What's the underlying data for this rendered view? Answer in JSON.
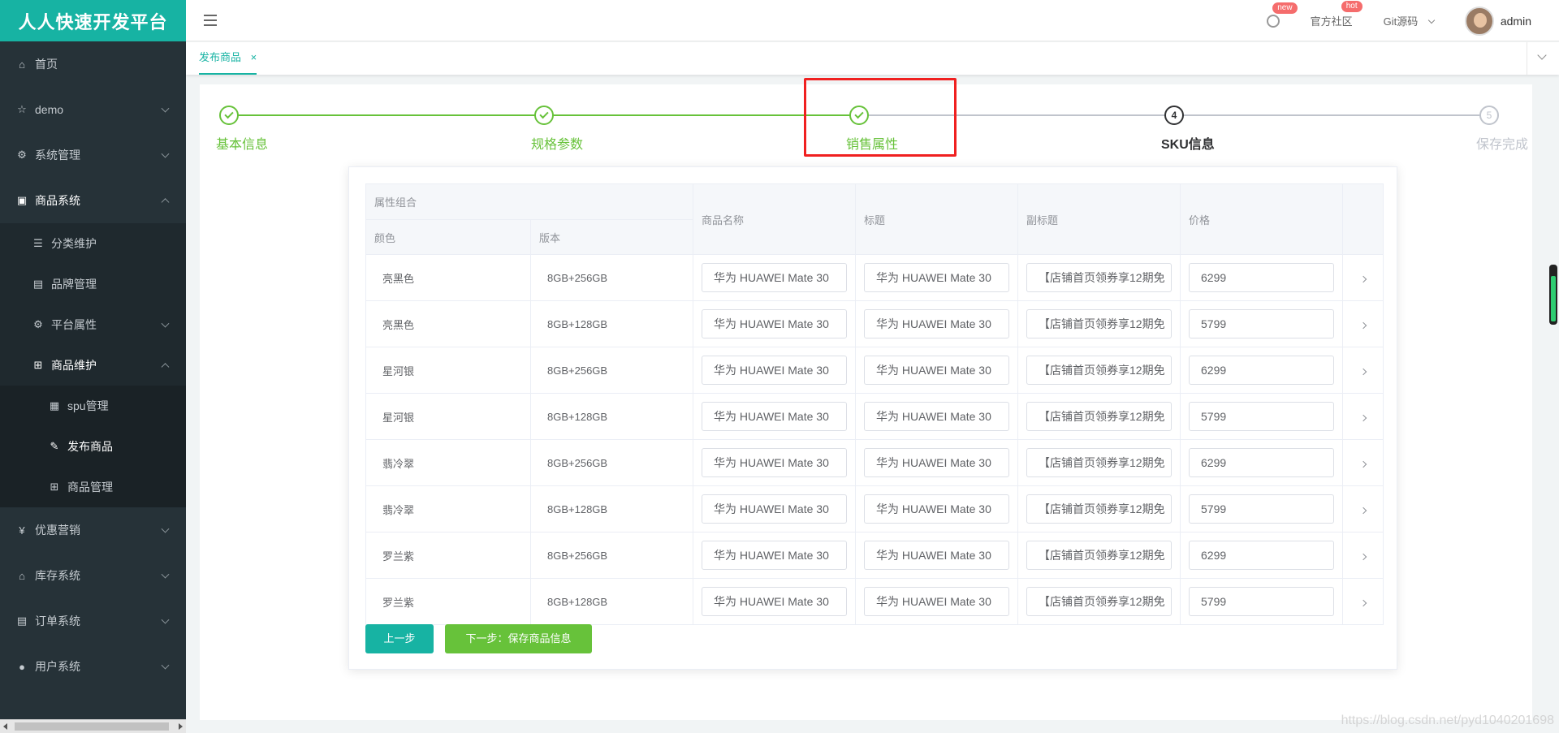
{
  "brand": "人人快速开发平台",
  "sidebar": {
    "items": [
      {
        "label": "首页",
        "icon": "home-icon"
      },
      {
        "label": "demo",
        "icon": "star-icon"
      },
      {
        "label": "系统管理",
        "icon": "gear-icon"
      },
      {
        "label": "商品系统",
        "icon": "product-icon"
      },
      {
        "label": "分类维护",
        "icon": "list-icon"
      },
      {
        "label": "品牌管理",
        "icon": "brand-icon"
      },
      {
        "label": "平台属性",
        "icon": "gear-icon"
      },
      {
        "label": "商品维护",
        "icon": "grid-icon"
      },
      {
        "label": "spu管理",
        "icon": "doc-icon"
      },
      {
        "label": "发布商品",
        "icon": "edit-icon"
      },
      {
        "label": "商品管理",
        "icon": "grid-icon"
      },
      {
        "label": "优惠营销",
        "icon": "discount-icon"
      },
      {
        "label": "库存系统",
        "icon": "warehouse-icon"
      },
      {
        "label": "订单系统",
        "icon": "order-icon"
      },
      {
        "label": "用户系统",
        "icon": "user-icon"
      }
    ]
  },
  "header": {
    "badge_new": "new",
    "community": "官方社区",
    "badge_hot": "hot",
    "git": "Git源码",
    "user": "admin"
  },
  "tabs": {
    "active": "发布商品",
    "close": "×"
  },
  "steps": [
    {
      "title": "基本信息",
      "status": "done"
    },
    {
      "title": "规格参数",
      "status": "done"
    },
    {
      "title": "销售属性",
      "status": "done"
    },
    {
      "title": "SKU信息",
      "status": "process",
      "num": "4"
    },
    {
      "title": "保存完成",
      "status": "wait",
      "num": "5"
    }
  ],
  "table": {
    "group_header": "属性组合",
    "headers": {
      "color": "颜色",
      "version": "版本",
      "name": "商品名称",
      "title": "标题",
      "subtitle": "副标题",
      "price": "价格"
    },
    "rows": [
      {
        "color": "亮黑色",
        "version": "8GB+256GB",
        "name": "华为 HUAWEI Mate 30",
        "title": "华为 HUAWEI Mate 30",
        "subtitle": "【店铺首页领券享12期免",
        "price": "6299"
      },
      {
        "color": "亮黑色",
        "version": "8GB+128GB",
        "name": "华为 HUAWEI Mate 30",
        "title": "华为 HUAWEI Mate 30",
        "subtitle": "【店铺首页领券享12期免",
        "price": "5799"
      },
      {
        "color": "星河银",
        "version": "8GB+256GB",
        "name": "华为 HUAWEI Mate 30",
        "title": "华为 HUAWEI Mate 30",
        "subtitle": "【店铺首页领券享12期免",
        "price": "6299"
      },
      {
        "color": "星河银",
        "version": "8GB+128GB",
        "name": "华为 HUAWEI Mate 30",
        "title": "华为 HUAWEI Mate 30",
        "subtitle": "【店铺首页领券享12期免",
        "price": "5799"
      },
      {
        "color": "翡冷翠",
        "version": "8GB+256GB",
        "name": "华为 HUAWEI Mate 30",
        "title": "华为 HUAWEI Mate 30",
        "subtitle": "【店铺首页领券享12期免",
        "price": "6299"
      },
      {
        "color": "翡冷翠",
        "version": "8GB+128GB",
        "name": "华为 HUAWEI Mate 30",
        "title": "华为 HUAWEI Mate 30",
        "subtitle": "【店铺首页领券享12期免",
        "price": "5799"
      },
      {
        "color": "罗兰紫",
        "version": "8GB+256GB",
        "name": "华为 HUAWEI Mate 30",
        "title": "华为 HUAWEI Mate 30",
        "subtitle": "【店铺首页领券享12期免",
        "price": "6299"
      },
      {
        "color": "罗兰紫",
        "version": "8GB+128GB",
        "name": "华为 HUAWEI Mate 30",
        "title": "华为 HUAWEI Mate 30",
        "subtitle": "【店铺首页领券享12期免",
        "price": "5799"
      }
    ]
  },
  "buttons": {
    "prev": "上一步",
    "next": "下一步：保存商品信息"
  },
  "watermark": "https://blog.csdn.net/pyd1040201698",
  "colors": {
    "brand": "#17b3a3",
    "sidebar": "#263238",
    "done": "#67c23a",
    "highlight": "#f02020"
  }
}
